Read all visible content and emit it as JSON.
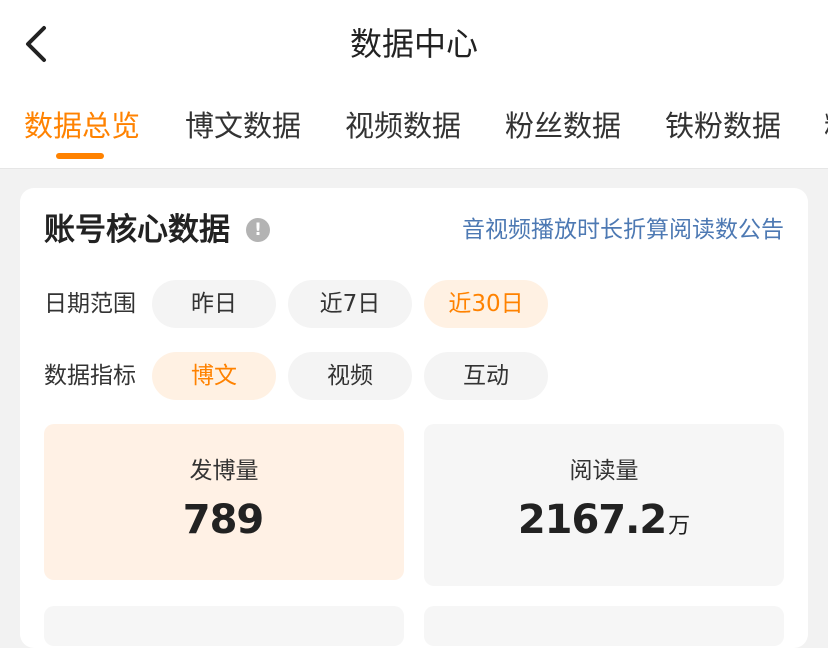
{
  "header": {
    "title": "数据中心"
  },
  "tabs": [
    {
      "label": "数据总览",
      "active": true
    },
    {
      "label": "博文数据",
      "active": false
    },
    {
      "label": "视频数据",
      "active": false
    },
    {
      "label": "粉丝数据",
      "active": false
    },
    {
      "label": "铁粉数据",
      "active": false
    },
    {
      "label": "粉",
      "active": false
    }
  ],
  "card": {
    "title": "账号核心数据",
    "info_icon": "info-icon",
    "notice_link": "音视频播放时长折算阅读数公告",
    "date_range": {
      "label": "日期范围",
      "options": [
        "昨日",
        "近7日",
        "近30日"
      ],
      "selected": "近30日"
    },
    "metric": {
      "label": "数据指标",
      "options": [
        "博文",
        "视频",
        "互动"
      ],
      "selected": "博文"
    },
    "stats": [
      {
        "label": "发博量",
        "value": "789",
        "unit": ""
      },
      {
        "label": "阅读量",
        "value": "2167.2",
        "unit": "万"
      }
    ]
  },
  "colors": {
    "accent": "#ff8200",
    "link": "#4d79b3",
    "background": "#f2f2f2"
  }
}
